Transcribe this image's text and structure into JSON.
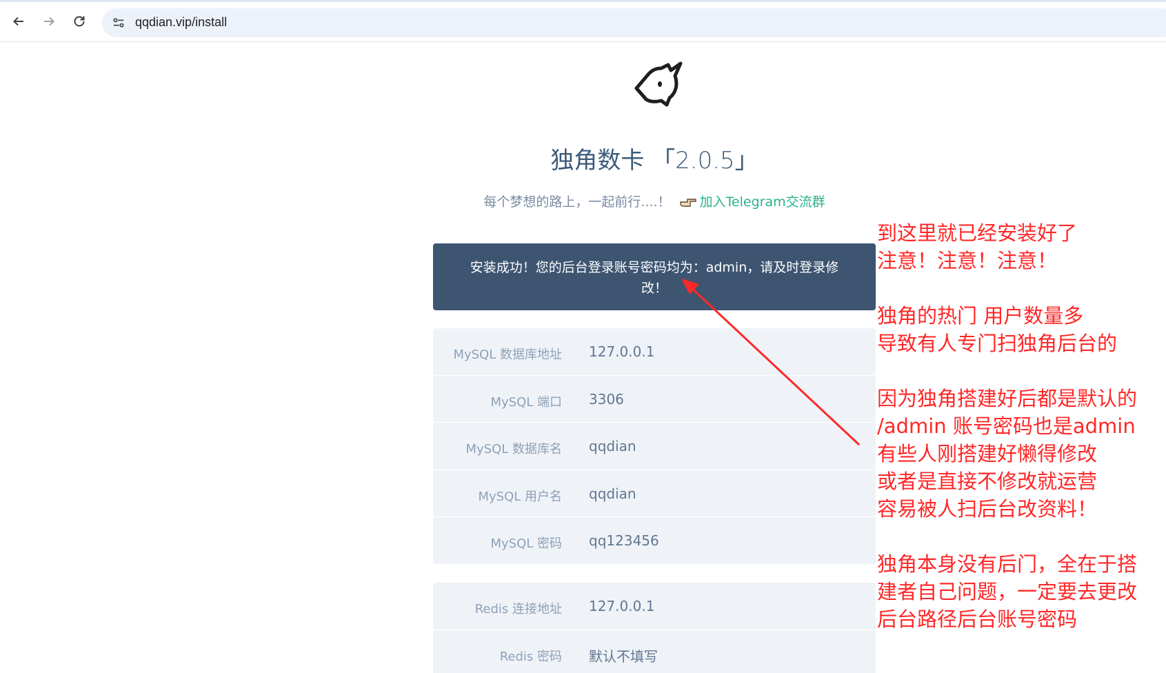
{
  "browser": {
    "url": "qqdian.vip/install",
    "back_icon": "arrow-left-icon",
    "forward_icon": "arrow-right-icon",
    "reload_icon": "reload-icon",
    "site_info_icon": "tune-icon"
  },
  "page": {
    "title": "独角数卡 「2.0.5」",
    "subtitle": "每个梦想的路上，一起前行....！",
    "telegram_link": "加入Telegram交流群",
    "success_message": "安装成功！您的后台登录账号密码均为：admin，请及时登录修改！",
    "mysql": [
      {
        "label": "MySQL 数据库地址",
        "value": "127.0.0.1"
      },
      {
        "label": "MySQL 端口",
        "value": "3306"
      },
      {
        "label": "MySQL 数据库名",
        "value": "qqdian"
      },
      {
        "label": "MySQL 用户名",
        "value": "qqdian"
      },
      {
        "label": "MySQL 密码",
        "value": "qq123456"
      }
    ],
    "redis": [
      {
        "label": "Redis 连接地址",
        "value": "127.0.0.1"
      },
      {
        "label": "Redis 密码",
        "value": "默认不填写"
      }
    ]
  },
  "annotation": {
    "p1": [
      "到这里就已经安装好了",
      "注意！注意！注意！"
    ],
    "p2": [
      "独角的热门 用户数量多",
      "导致有人专门扫独角后台的"
    ],
    "p3": [
      "因为独角搭建好后都是默认的",
      "/admin  账号密码也是admin",
      "有些人刚搭建好懒得修改",
      "或者是直接不修改就运营",
      "容易被人扫后台改资料！"
    ],
    "p4": [
      "独角本身没有后门，全在于搭",
      "建者自己问题，一定要去更改",
      "后台路径后台账号密码"
    ],
    "color": "#ff2727"
  },
  "colors": {
    "banner": "#3d5571",
    "card": "#eff3f8",
    "link": "#27b48c"
  }
}
